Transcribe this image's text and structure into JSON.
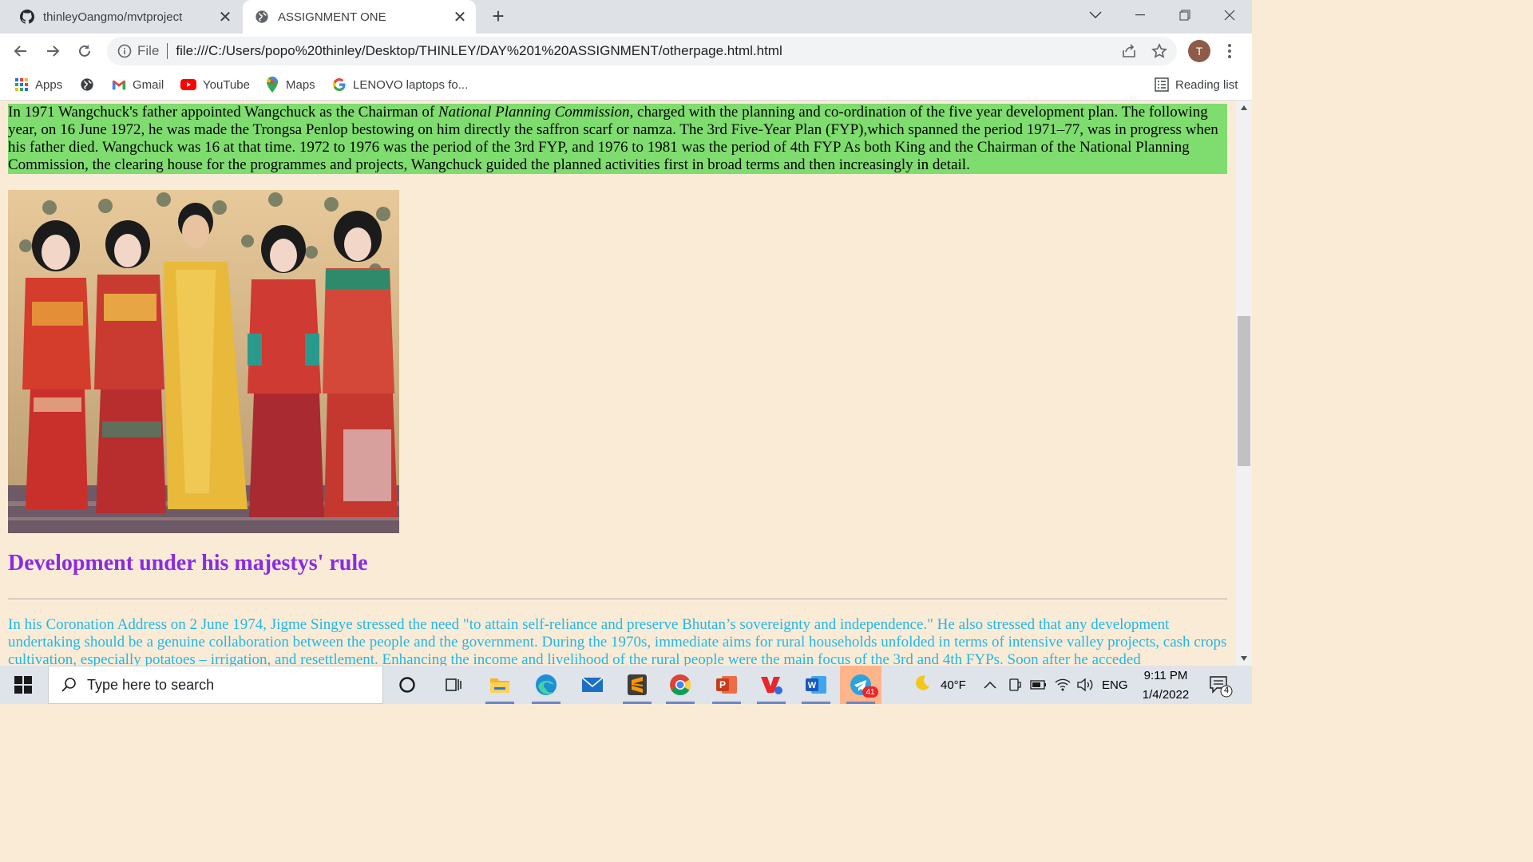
{
  "browser": {
    "tabs": [
      {
        "title": "thinleyOangmo/mvtproject",
        "favicon": "github-icon",
        "active": false
      },
      {
        "title": "ASSIGNMENT ONE",
        "favicon": "globe-icon",
        "active": true
      }
    ],
    "address": {
      "scheme_label": "File",
      "url": "file:///C:/Users/popo%20thinley/Desktop/THINLEY/DAY%201%20ASSIGNMENT/otherpage.html.html"
    },
    "profile_initial": "T",
    "bookmarks": [
      {
        "label": "Apps",
        "icon": "apps-grid-icon"
      },
      {
        "label": "",
        "icon": "globe-icon"
      },
      {
        "label": "Gmail",
        "icon": "gmail-icon"
      },
      {
        "label": "YouTube",
        "icon": "youtube-icon"
      },
      {
        "label": "Maps",
        "icon": "maps-pin-icon"
      },
      {
        "label": "LENOVO laptops fo...",
        "icon": "google-icon"
      }
    ],
    "reading_list_label": "Reading list"
  },
  "page": {
    "para1": {
      "before": "In 1971 Wangchuck's father appointed Wangchuck as the Chairman of ",
      "em": "National Planning Commission",
      "after": ", charged with the planning and co-ordination of the five year development plan. The following year, on 16 June 1972, he was made the Trongsa Penlop bestowing on him directly the saffron scarf or namza. The 3rd Five-Year Plan (FYP),which spanned the period 1971–77, was in progress when his father died. Wangchuck was 16 at that time. 1972 to 1976 was the period of the 3rd FYP, and 1976 to 1981 was the period of 4th FYP As both King and the Chairman of the National Planning Commission, the clearing house for the programmes and projects, Wangchuck guided the planned activities first in broad terms and then increasingly in detail."
    },
    "heading": "Development under his majestys' rule",
    "para2": "In his Coronation Address on 2 June 1974, Jigme Singye stressed the need \"to attain self-reliance and preserve Bhutan’s sovereignty and independence.\" He also stressed that any development undertaking should be a genuine collaboration between the people and the government. During the 1970s, immediate aims for rural households unfolded in terms of intensive valley projects, cash crops cultivation, especially potatoes – irrigation, and resettlement. Enhancing the income and livelihood of the rural people were the main focus of the 3rd and 4th FYPs. Soon after he acceded",
    "colors": {
      "background": "#faebd7",
      "highlight": "#7fdd6f",
      "heading": "#8a2be2",
      "body_cyan": "#1fb8e6"
    }
  },
  "taskbar": {
    "search_placeholder": "Type here to search",
    "apps": [
      "cortana-icon",
      "task-view-icon",
      "file-explorer-icon",
      "edge-icon",
      "mail-icon",
      "sublime-text-icon",
      "chrome-icon",
      "powerpoint-icon",
      "wps-writer-icon",
      "word-icon",
      "telegram-icon"
    ],
    "telegram_badge": "41",
    "weather": "40°F",
    "language": "ENG",
    "time": "9:11 PM",
    "date": "1/4/2022",
    "notifications": "4"
  }
}
